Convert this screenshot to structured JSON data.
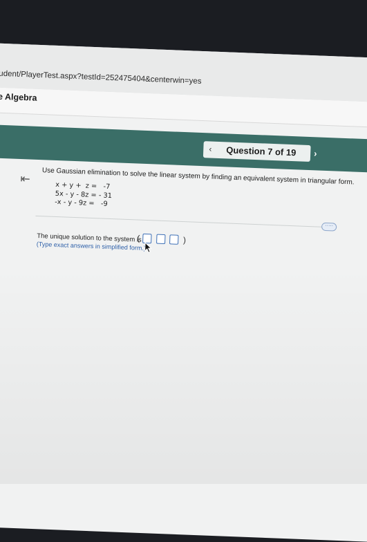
{
  "browser": {
    "url": "udent/PlayerTest.aspx?testId=252475404&centerwin=yes"
  },
  "course": {
    "title": "e Algebra"
  },
  "navigation": {
    "prev_icon": "chevron-left-icon",
    "question_label": "Question 7 of 19",
    "next_icon": "chevron-right-icon"
  },
  "question": {
    "collapse_icon": "collapse-left-icon",
    "instruction": "Use Gaussian elimination to solve the linear system by finding an equivalent system in triangular form.",
    "equations": [
      "x + y +  z =   -7",
      "5x - y - 8z = - 31",
      "-x - y - 9z =   -9"
    ],
    "more_button": "·····",
    "answer_prompt": "The unique solution to the system is",
    "hint": "(Type exact answers in simplified form.)"
  },
  "colors": {
    "header_teal": "#3a6e67",
    "link_blue": "#2d5fa8"
  }
}
